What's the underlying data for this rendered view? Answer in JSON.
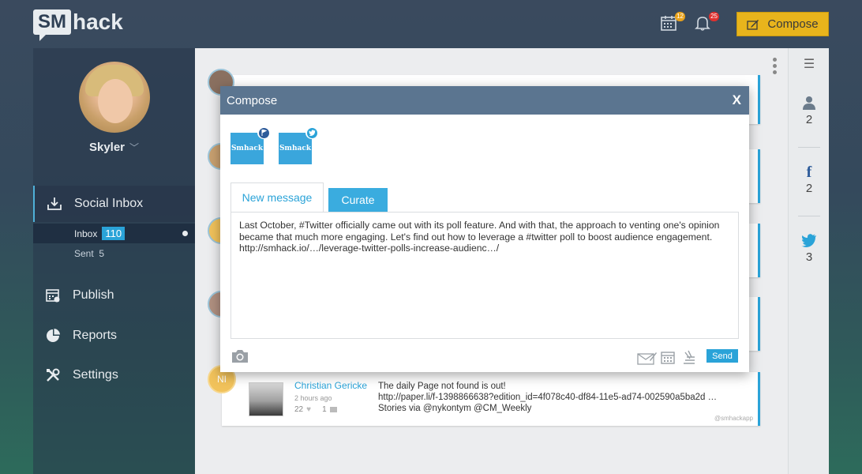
{
  "app": {
    "logo_box": "SM",
    "logo_text": "hack"
  },
  "topbar": {
    "calendar_badge": "12",
    "notification_badge": "25",
    "compose_label": "Compose"
  },
  "sidebar": {
    "user_name": "Skyler",
    "items": [
      {
        "label": "Social Inbox"
      },
      {
        "label": "Publish"
      },
      {
        "label": "Reports"
      },
      {
        "label": "Settings"
      }
    ],
    "inbox_label": "Inbox",
    "inbox_count": "110",
    "sent_label": "Sent",
    "sent_count": "5"
  },
  "right_panel": {
    "users_count": "2",
    "facebook_count": "2",
    "twitter_count": "3"
  },
  "modal": {
    "title": "Compose",
    "close_label": "X",
    "account_1_label": "Smhack",
    "account_2_label": "Smhack",
    "tab_new": "New message",
    "tab_curate": "Curate",
    "message": "Last October, #Twitter officially came out with its poll feature. And with that, the approach to venting one's opinion became that much more engaging. Let's find out how to leverage a #twitter poll to boost audience engagement. http://smhack.io/…/leverage-twitter-polls-increase-audienc…/",
    "send_label": "Send"
  },
  "feed": {
    "card_footer": "pp",
    "bottom_card": {
      "avatar_initials": "NI",
      "author": "Christian Gericke",
      "time": "2 hours ago",
      "likes": "22",
      "comments": "1",
      "text_line1": "The daily Page not found is out!",
      "text_line2": "http://paper.li/f-1398866638?edition_id=4f078c40-df84-11e5-ad74-002590a5ba2d …",
      "text_line3": "Stories via @nykontym @CM_Weekly",
      "source": "@smhackapp"
    }
  },
  "colors": {
    "accent": "#2aa3d8",
    "compose_button": "#e8b41c",
    "modal_header": "#5b7590"
  }
}
